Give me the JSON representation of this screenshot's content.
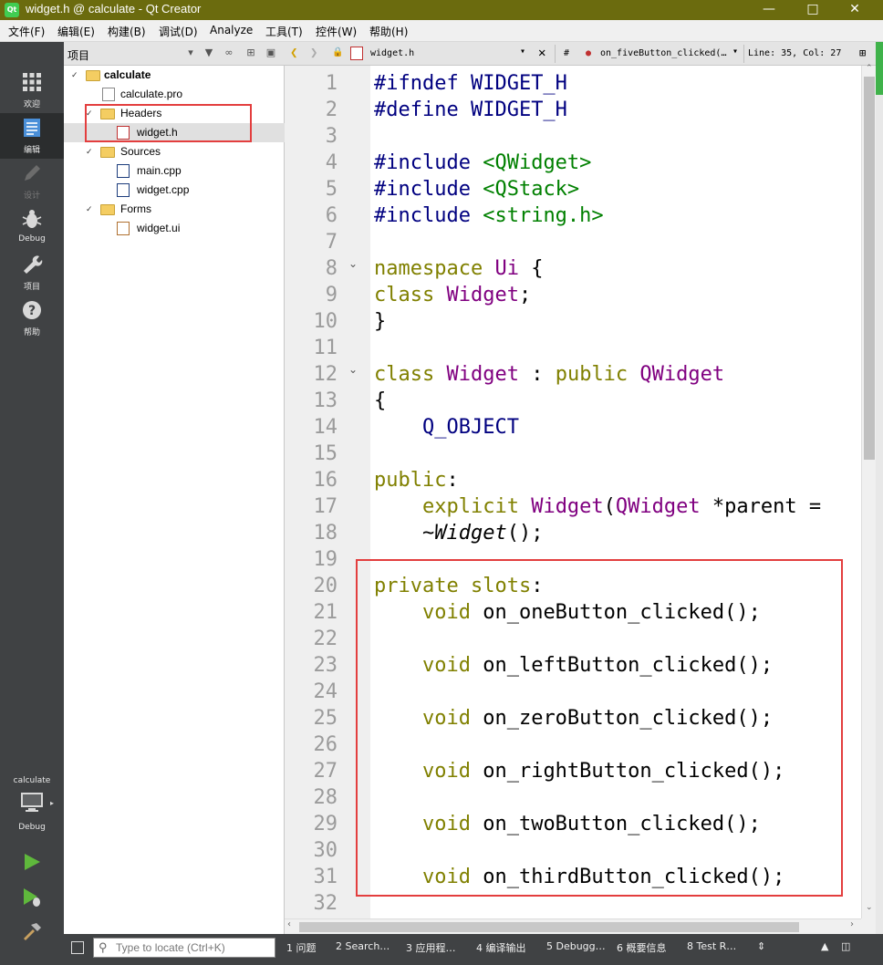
{
  "window": {
    "title": "widget.h @ calculate - Qt Creator",
    "app_icon": "qt-icon"
  },
  "menu": [
    "文件(F)",
    "编辑(E)",
    "构建(B)",
    "调试(D)",
    "Analyze",
    "工具(T)",
    "控件(W)",
    "帮助(H)"
  ],
  "modes": {
    "welcome": "欢迎",
    "edit": "编辑",
    "design": "设计",
    "debug": "Debug",
    "projects": "项目",
    "help": "帮助"
  },
  "kit": {
    "project": "calculate",
    "build": "Debug"
  },
  "project_pane": {
    "title": "项目",
    "tree": {
      "root": "calculate",
      "pro_file": "calculate.pro",
      "headers": "Headers",
      "header_file": "widget.h",
      "sources": "Sources",
      "source_1": "main.cpp",
      "source_2": "widget.cpp",
      "forms": "Forms",
      "form_file": "widget.ui"
    }
  },
  "editor_toolbar": {
    "file": "widget.h",
    "hash": "#",
    "symbol": "on_fiveButton_clicked(…",
    "position": "Line: 35, Col: 27"
  },
  "code": {
    "line_numbers": [
      "1",
      "2",
      "3",
      "4",
      "5",
      "6",
      "7",
      "8",
      "9",
      "10",
      "11",
      "12",
      "13",
      "14",
      "15",
      "16",
      "17",
      "18",
      "19",
      "20",
      "21",
      "22",
      "23",
      "24",
      "25",
      "26",
      "27",
      "28",
      "29",
      "30",
      "31",
      "32"
    ],
    "l1_a": "#ifndef",
    "l1_b": " WIDGET_H",
    "l2_a": "#define",
    "l2_b": " WIDGET_H",
    "l4_a": "#include",
    "l4_b": " <QWidget>",
    "l5_a": "#include",
    "l5_b": " <QStack>",
    "l6_a": "#include",
    "l6_b": " <string.h>",
    "l8_a": "namespace",
    "l8_b": " Ui",
    "l8_c": " {",
    "l9_a": "class",
    "l9_b": " Widget",
    "l9_c": ";",
    "l10": "}",
    "l12_a": "class",
    "l12_b": " Widget",
    "l12_c": " : ",
    "l12_d": "public",
    "l12_e": " QWidget",
    "l13": "{",
    "l14": "    Q_OBJECT",
    "l16_a": "public",
    "l16_b": ":",
    "l17_a": "    explicit",
    "l17_b": " Widget",
    "l17_c": "(",
    "l17_d": "QWidget",
    "l17_e": " *parent =",
    "l18_a": "    ~",
    "l18_b": "Widget",
    "l18_c": "();",
    "l20_a": "private slots",
    "l20_b": ":",
    "l21_a": "    void",
    "l21_b": " on_oneButton_clicked();",
    "l23_a": "    void",
    "l23_b": " on_leftButton_clicked();",
    "l25_a": "    void",
    "l25_b": " on_zeroButton_clicked();",
    "l27_a": "    void",
    "l27_b": " on_rightButton_clicked();",
    "l29_a": "    void",
    "l29_b": " on_twoButton_clicked();",
    "l31_a": "    void",
    "l31_b": " on_thirdButton_clicked();"
  },
  "status": {
    "locator_placeholder": "Type to locate (Ctrl+K)",
    "tabs": [
      "1  问题",
      "2  Search…",
      "3  应用程…",
      "4  编译输出",
      "5  Debugg…",
      "6  概要信息",
      "8  Test R…"
    ]
  },
  "colors": {
    "titlebar": "#6b6b0e",
    "keyword": "#808000",
    "type": "#800080",
    "preprocessor": "#000080",
    "include": "#008000",
    "annotation_box": "#e33e3e",
    "mode_bar": "#404244"
  }
}
